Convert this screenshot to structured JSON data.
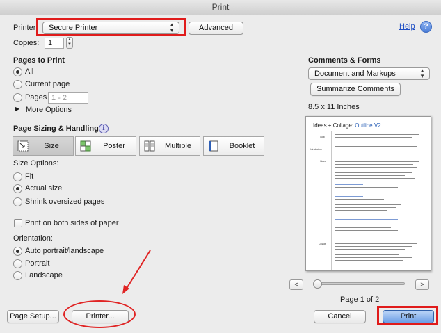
{
  "window": {
    "title": "Print"
  },
  "printer": {
    "label": "Printer:",
    "selected": "Secure Printer",
    "advanced_button": "Advanced"
  },
  "help": {
    "link": "Help",
    "icon": "question-icon"
  },
  "copies": {
    "label": "Copies:",
    "value": "1"
  },
  "pages": {
    "heading": "Pages to Print",
    "options": [
      "All",
      "Current page",
      "Pages"
    ],
    "selected": "All",
    "range_placeholder": "1 - 2",
    "more_options": "More Options"
  },
  "sizing": {
    "heading": "Page Sizing & Handling",
    "modes": [
      "Size",
      "Poster",
      "Multiple",
      "Booklet"
    ],
    "selected_mode": "Size",
    "size_options_label": "Size Options:",
    "size_options": [
      "Fit",
      "Actual size",
      "Shrink oversized pages"
    ],
    "selected_size_option": "Actual size",
    "both_sides": "Print on both sides of paper"
  },
  "orientation": {
    "label": "Orientation:",
    "options": [
      "Auto portrait/landscape",
      "Portrait",
      "Landscape"
    ],
    "selected": "Auto portrait/landscape"
  },
  "comments": {
    "heading": "Comments & Forms",
    "selected": "Document and Markups",
    "summarize_button": "Summarize Comments"
  },
  "preview": {
    "paper_size": "8.5 x 11 Inches",
    "doc_title_main": "Ideas + Collage:",
    "doc_title_outline": "Outline V2",
    "side_labels": [
      "Goal",
      "Introduction",
      "Ideas",
      "Collage"
    ],
    "prev_button": "<",
    "next_button": ">",
    "page_indicator": "Page 1 of 2",
    "slider_position": 0
  },
  "footer": {
    "page_setup": "Page Setup...",
    "printer": "Printer...",
    "cancel": "Cancel",
    "print": "Print"
  },
  "colors": {
    "highlight_red": "#e01b1b",
    "print_button_blue": "#6c9ee6",
    "link_blue": "#1f4fc4",
    "doc_blue": "#2d62b8"
  }
}
